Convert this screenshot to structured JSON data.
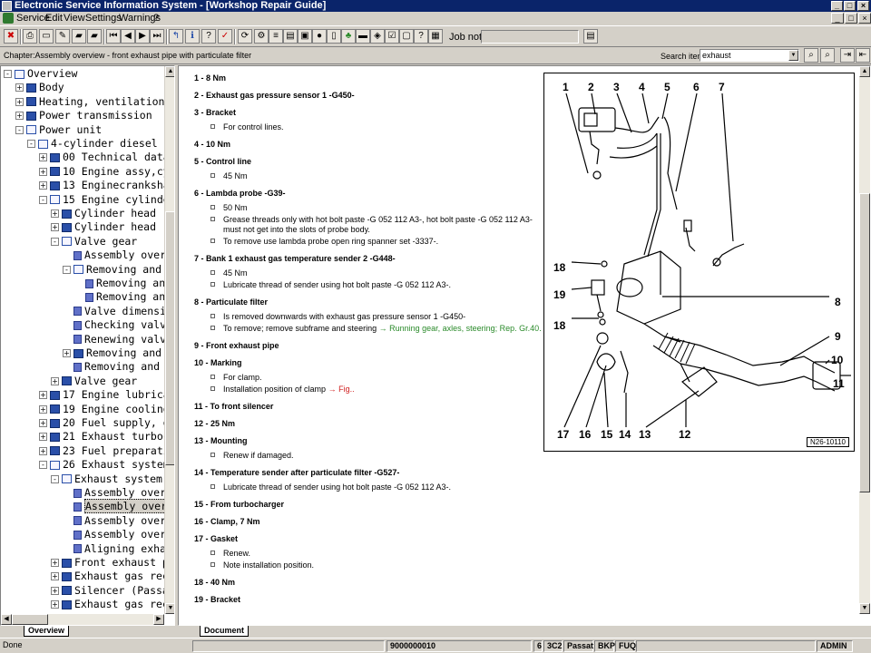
{
  "window": {
    "title": "Electronic Service Information System - [Workshop Repair Guide]",
    "buttons": [
      "_",
      "□",
      "×"
    ]
  },
  "menu": {
    "items": [
      "Service",
      "Edit",
      "View",
      "Settings",
      "Warnings",
      "?"
    ]
  },
  "toolbar": {
    "job_note_label": "Job note:",
    "job_note_value": ""
  },
  "chapter": {
    "text": "Chapter:Assembly overview - front exhaust pipe with particulate filter",
    "search_label": "Search item:",
    "search_value": "exhaust"
  },
  "tree": {
    "items": [
      {
        "label": "Overview",
        "level": 0,
        "expander": "-",
        "icon": "open"
      },
      {
        "label": "Body",
        "level": 1,
        "expander": "+",
        "icon": "closed"
      },
      {
        "label": "Heating, ventilation",
        "level": 1,
        "expander": "+",
        "icon": "closed"
      },
      {
        "label": "Power transmission",
        "level": 1,
        "expander": "+",
        "icon": "closed"
      },
      {
        "label": "Power unit",
        "level": 1,
        "expander": "-",
        "icon": "open"
      },
      {
        "label": "4-cylinder diesel e",
        "level": 2,
        "expander": "-",
        "icon": "open"
      },
      {
        "label": "00 Technical data",
        "level": 3,
        "expander": "+",
        "icon": "closed"
      },
      {
        "label": "10 Engine assy,cy",
        "level": 3,
        "expander": "+",
        "icon": "closed"
      },
      {
        "label": "13 Enginecranksha",
        "level": 3,
        "expander": "+",
        "icon": "closed"
      },
      {
        "label": "15 Engine cylinde",
        "level": 3,
        "expander": "-",
        "icon": "open"
      },
      {
        "label": "Cylinder head",
        "level": 4,
        "expander": "+",
        "icon": "closed"
      },
      {
        "label": "Cylinder head",
        "level": 4,
        "expander": "+",
        "icon": "closed"
      },
      {
        "label": "Valve gear",
        "level": 4,
        "expander": "-",
        "icon": "open"
      },
      {
        "label": "Assembly over",
        "level": 5,
        "expander": "",
        "icon": "doc"
      },
      {
        "label": "Removing and",
        "level": 5,
        "expander": "-",
        "icon": "open"
      },
      {
        "label": "Removing an",
        "level": 6,
        "expander": "",
        "icon": "doc"
      },
      {
        "label": "Removing an",
        "level": 6,
        "expander": "",
        "icon": "doc"
      },
      {
        "label": "Valve dimensi",
        "level": 5,
        "expander": "",
        "icon": "doc"
      },
      {
        "label": "Checking valv",
        "level": 5,
        "expander": "",
        "icon": "doc"
      },
      {
        "label": "Renewing valv",
        "level": 5,
        "expander": "",
        "icon": "doc"
      },
      {
        "label": "Removing and",
        "level": 5,
        "expander": "+",
        "icon": "closed"
      },
      {
        "label": "Removing and",
        "level": 5,
        "expander": "",
        "icon": "doc"
      },
      {
        "label": "Valve gear",
        "level": 4,
        "expander": "+",
        "icon": "closed"
      },
      {
        "label": "17 Engine lubrica",
        "level": 3,
        "expander": "+",
        "icon": "closed"
      },
      {
        "label": "19 Engine cooling",
        "level": 3,
        "expander": "+",
        "icon": "closed"
      },
      {
        "label": "20 Fuel supply, g",
        "level": 3,
        "expander": "+",
        "icon": "closed"
      },
      {
        "label": "21 Exhaust turboc",
        "level": 3,
        "expander": "+",
        "icon": "closed"
      },
      {
        "label": "23 Fuel preparati",
        "level": 3,
        "expander": "+",
        "icon": "closed"
      },
      {
        "label": "26 Exhaust system",
        "level": 3,
        "expander": "-",
        "icon": "open"
      },
      {
        "label": "Exhaust system",
        "level": 4,
        "expander": "-",
        "icon": "open"
      },
      {
        "label": "Assembly over",
        "level": 5,
        "expander": "",
        "icon": "doc"
      },
      {
        "label": "Assembly over",
        "level": 5,
        "expander": "",
        "icon": "doc",
        "selected": true
      },
      {
        "label": "Assembly over",
        "level": 5,
        "expander": "",
        "icon": "doc"
      },
      {
        "label": "Assembly over",
        "level": 5,
        "expander": "",
        "icon": "doc"
      },
      {
        "label": "Aligning exha",
        "level": 5,
        "expander": "",
        "icon": "doc"
      },
      {
        "label": "Front exhaust p",
        "level": 4,
        "expander": "+",
        "icon": "closed"
      },
      {
        "label": "Exhaust gas rec",
        "level": 4,
        "expander": "+",
        "icon": "closed"
      },
      {
        "label": "Silencer (Passa",
        "level": 4,
        "expander": "+",
        "icon": "closed"
      },
      {
        "label": "Exhaust gas rec",
        "level": 4,
        "expander": "+",
        "icon": "closed"
      }
    ]
  },
  "tabs": {
    "tree_tab": "Overview",
    "doc_tab": "Document"
  },
  "document": {
    "items": [
      {
        "title": "1 - 8 Nm",
        "subs": []
      },
      {
        "title": "2 - Exhaust gas pressure sensor 1 -G450-",
        "subs": []
      },
      {
        "title": "3 - Bracket",
        "subs": [
          {
            "text": "For control lines."
          }
        ]
      },
      {
        "title": "4 - 10 Nm",
        "subs": []
      },
      {
        "title": "5 - Control line",
        "subs": [
          {
            "text": "45 Nm"
          }
        ]
      },
      {
        "title": "6 - Lambda probe -G39-",
        "subs": [
          {
            "text": "50 Nm"
          },
          {
            "text": "Grease threads only with hot bolt paste -G 052 112 A3-, hot bolt paste -G 052 112 A3- must not get into the slots of probe body."
          },
          {
            "text": "To remove use lambda probe open ring spanner set -3337-."
          }
        ]
      },
      {
        "title": "7 - Bank 1 exhaust gas temperature sender 2 -G448-",
        "subs": [
          {
            "text": "45 Nm"
          },
          {
            "text": "Lubricate thread of sender using hot bolt paste -G 052 112 A3-."
          }
        ]
      },
      {
        "title": "8 - Particulate filter",
        "subs": [
          {
            "text": "Is removed downwards with exhaust gas pressure sensor 1 -G450-"
          },
          {
            "text": "To remove; remove subframe and steering ",
            "link": "→ Running gear, axles, steering; Rep. Gr.40.",
            "link_color": "green"
          }
        ]
      },
      {
        "title": "9 - Front exhaust pipe",
        "subs": []
      },
      {
        "title": "10 - Marking",
        "subs": [
          {
            "text": "For clamp."
          },
          {
            "text": "Installation position of clamp ",
            "link": "→ Fig..",
            "link_color": "red"
          }
        ]
      },
      {
        "title": "11 - To front silencer",
        "subs": []
      },
      {
        "title": "12 - 25 Nm",
        "subs": []
      },
      {
        "title": "13 - Mounting",
        "subs": [
          {
            "text": "Renew if damaged."
          }
        ]
      },
      {
        "title": "14 - Temperature sender after particulate filter -G527-",
        "subs": [
          {
            "text": "Lubricate thread of sender using hot bolt paste -G 052 112 A3-."
          }
        ]
      },
      {
        "title": "15 - From turbocharger",
        "subs": []
      },
      {
        "title": "16 - Clamp, 7 Nm",
        "subs": []
      },
      {
        "title": "17 - Gasket",
        "subs": [
          {
            "text": "Renew."
          },
          {
            "text": "Note installation position."
          }
        ]
      },
      {
        "title": "18 - 40 Nm",
        "subs": []
      },
      {
        "title": "19 - Bracket",
        "subs": []
      }
    ]
  },
  "figure": {
    "id": "N26-10110",
    "callouts_top": [
      "1",
      "2",
      "3",
      "4",
      "5",
      "6",
      "7"
    ],
    "callouts_bottom": [
      "17",
      "16",
      "15",
      "14",
      "13",
      "12"
    ],
    "callouts_left": [
      "18",
      "19",
      "18"
    ],
    "callouts_right": [
      "8",
      "9",
      "10",
      "11"
    ]
  },
  "status": {
    "left": "Done",
    "code": "9000000010",
    "f1": "6",
    "f2": "3C2",
    "f3": "Passat",
    "f4": "BKP",
    "f5": "FUQ",
    "user": "ADMIN"
  },
  "colors": {
    "titlebar": "#0a246a",
    "link_green": "#2a8a2a",
    "link_red": "#d02020",
    "book_blue": "#2a4fa8"
  }
}
